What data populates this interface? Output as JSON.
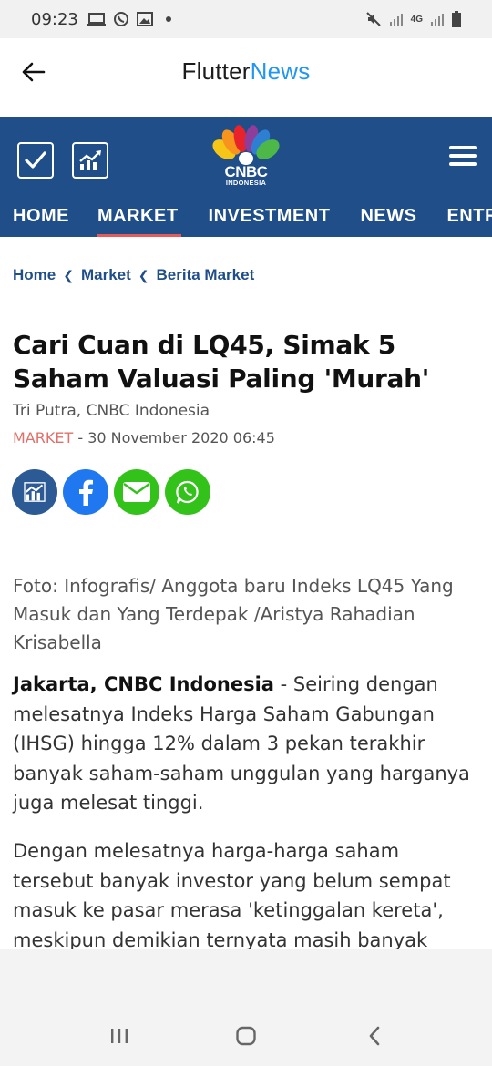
{
  "status_bar": {
    "time": "09:23",
    "network": "4G"
  },
  "app_bar": {
    "title_part1": "Flutter",
    "title_part2": "News"
  },
  "cnbc": {
    "logo_text": "CNBC",
    "logo_subtext": "INDONESIA"
  },
  "nav": {
    "tabs": [
      "HOME",
      "MARKET",
      "INVESTMENT",
      "NEWS",
      "ENTR"
    ],
    "active": "MARKET"
  },
  "breadcrumb": {
    "items": [
      "Home",
      "Market",
      "Berita Market"
    ]
  },
  "article": {
    "title": "Cari Cuan di LQ45, Simak 5 Saham Valuasi Paling 'Murah'",
    "author": "Tri Putra, CNBC Indonesia",
    "category": "MARKET",
    "date": " - 30 November 2020 06:45",
    "caption": "Foto: Infografis/ Anggota baru Indeks LQ45 Yang Masuk dan Yang Terdepak /Aristya Rahadian Krisabella",
    "lead": "Jakarta, CNBC Indonesia",
    "para1_rest": " - Seiring dengan melesatnya Indeks Harga Saham Gabungan (IHSG) hingga 12% dalam 3 pekan terakhir banyak saham-saham unggulan yang harganya juga melesat tinggi.",
    "para2": "Dengan melesatnya harga-harga saham tersebut banyak investor yang belum sempat masuk ke pasar merasa 'ketinggalan kereta', meskipun demikian ternyata masih banyak saham-saham"
  },
  "colors": {
    "brand_blue": "#1f4e89",
    "accent_blue": "#2196f3",
    "category_red": "#e0706a",
    "facebook": "#1f78f0",
    "green": "#33c21a"
  }
}
